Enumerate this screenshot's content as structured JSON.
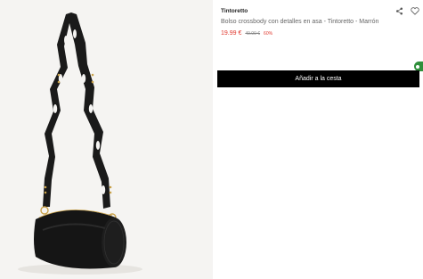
{
  "product": {
    "brand": "Tintoretto",
    "title": "Bolso crossbody con detalles en asa - Tintoretto - Marrón",
    "price_current": "19.99 €",
    "price_original": "49.99 €",
    "discount": "60%"
  },
  "actions": {
    "add_to_cart_label": "Añadir a la cesta",
    "share_icon": "share-icon",
    "wishlist_icon": "heart-icon"
  },
  "colors": {
    "sale_red": "#e0392f",
    "cart_button_bg": "#000000",
    "help_badge_green": "#2f8f3b"
  }
}
